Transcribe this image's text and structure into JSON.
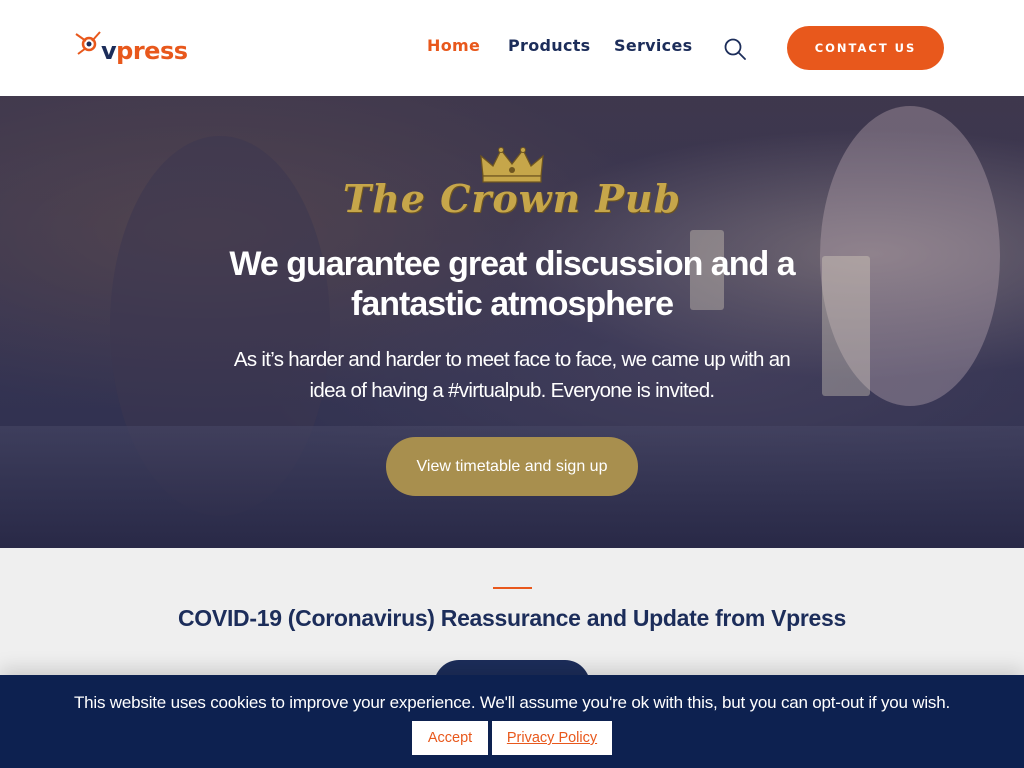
{
  "brand": {
    "logo_v": "v",
    "logo_rest": "press",
    "accent_color": "#e8581c",
    "navy_color": "#1c2d5a",
    "gold_color": "#a88f4e"
  },
  "nav": {
    "items": [
      {
        "label": "Home",
        "active": true
      },
      {
        "label": "Products",
        "active": false
      },
      {
        "label": "Services",
        "active": false
      }
    ],
    "search_icon": "search-icon",
    "contact_label": "CONTACT US"
  },
  "hero": {
    "pub_name": "The Crown Pub",
    "title": "We guarantee great discussion and a fantastic atmosphere",
    "subtitle": "As it’s harder and harder to meet face to face, we came up with an idea of having a #virtualpub. Everyone is invited.",
    "button_label": "View timetable and sign up"
  },
  "covid": {
    "title": "COVID-19 (Coronavirus) Reassurance and Update from Vpress"
  },
  "cookie": {
    "message": "This website uses cookies to improve your experience. We'll assume you're ok with this, but you can opt-out if you wish.",
    "accept_label": "Accept",
    "policy_label": "Privacy Policy"
  }
}
